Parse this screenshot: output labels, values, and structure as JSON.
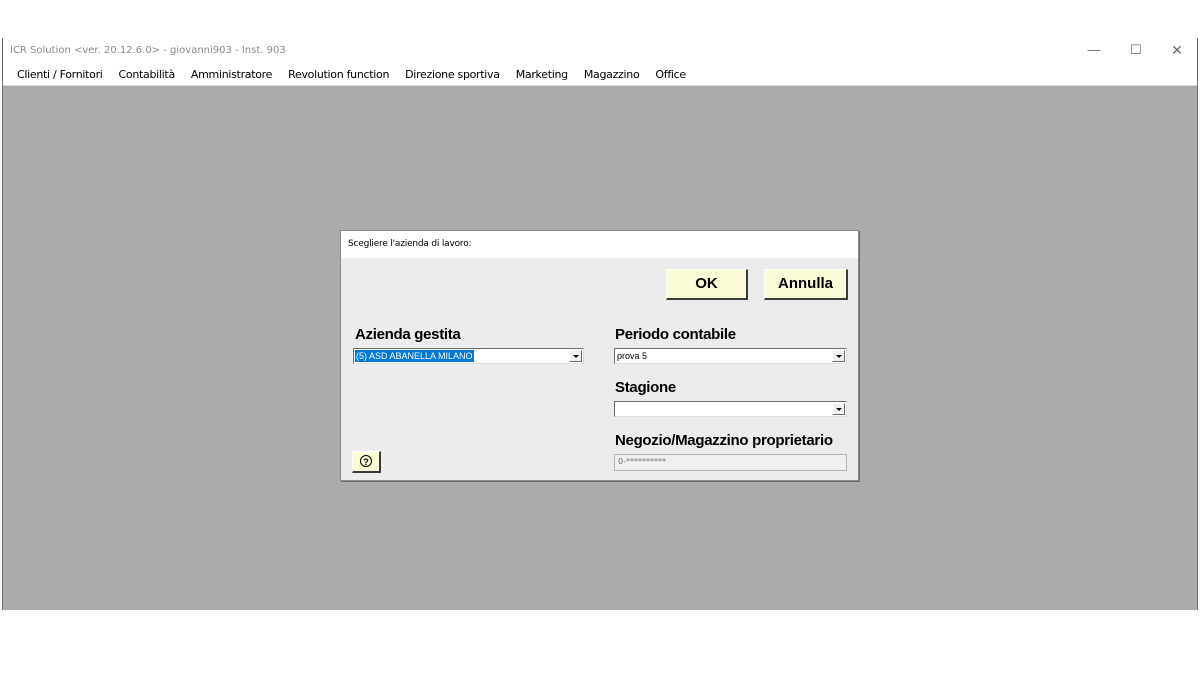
{
  "window": {
    "title": "ICR Solution <ver. 20.12.6.0>  -  giovanni903  -  Inst. 903",
    "controls": {
      "minimize": "—",
      "maximize": "☐",
      "close": "✕"
    }
  },
  "menu": {
    "items": [
      {
        "label": "Clienti / Fornitori"
      },
      {
        "label": "Contabilità"
      },
      {
        "label": "Amministratore"
      },
      {
        "label": "Revolution function"
      },
      {
        "label": "Direzione sportiva"
      },
      {
        "label": "Marketing"
      },
      {
        "label": "Magazzino"
      },
      {
        "label": "Office"
      }
    ]
  },
  "dialog": {
    "title": "Scegliere l'azienda di lavoro:",
    "ok_label": "OK",
    "cancel_label": "Annulla",
    "help_label": "?",
    "azienda": {
      "label": "Azienda gestita",
      "value": "(5) ASD ABANELLA MILANO"
    },
    "periodo": {
      "label": "Periodo contabile",
      "value": "prova 5"
    },
    "stagione": {
      "label": "Stagione",
      "value": ""
    },
    "negozio": {
      "label": "Negozio/Magazzino proprietario",
      "value": "0-**********"
    }
  },
  "colors": {
    "mdi_background": "#ababab",
    "button_face": "#fbfbd6",
    "selection": "#0078d7"
  }
}
